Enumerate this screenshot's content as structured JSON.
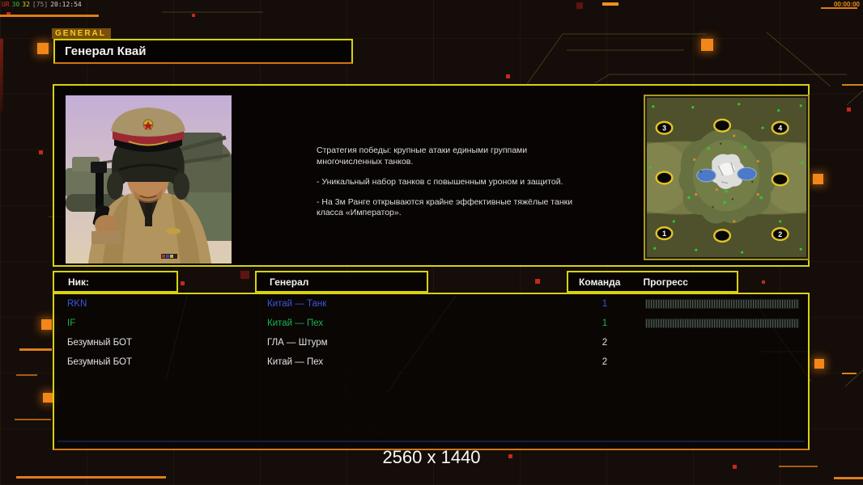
{
  "hud": {
    "debug_parts": [
      {
        "text": "UR",
        "color": "#d03020"
      },
      {
        "text": "30",
        "color": "#30c030"
      },
      {
        "text": "32",
        "color": "#d0d030"
      },
      {
        "text": "[75]",
        "color": "#909090"
      },
      {
        "text": "20:12:54",
        "color": "#d0d0d0"
      }
    ],
    "match_timer": "00:00:00",
    "resolution_label": "2560 x 1440"
  },
  "header": {
    "tab_label": "GENERAL",
    "title": "Генерал Квай"
  },
  "briefing": {
    "paragraphs": [
      "Стратегия победы: крупные атаки едиными группами многочисленных танков.",
      "- Уникальный набор танков с повышенным уроном и защитой.",
      "- На 3м Ранге открываются крайне эффективные тяжёлые танки класса «Император»."
    ]
  },
  "minimap": {
    "positions": [
      {
        "label": "3"
      },
      {
        "label": ""
      },
      {
        "label": "4"
      },
      {
        "label": ""
      },
      {
        "label": ""
      },
      {
        "label": "1"
      },
      {
        "label": ""
      },
      {
        "label": "2"
      }
    ]
  },
  "table": {
    "headers": {
      "nick": "Ник:",
      "general": "Генерал",
      "team": "Команда",
      "progress": "Прогресс"
    },
    "rows": [
      {
        "name": "RKN",
        "general": "Китай — Танк",
        "team": "1",
        "color": "#3c55e0",
        "has_progress": true
      },
      {
        "name": "IF",
        "general": "Китай — Пех",
        "team": "1",
        "color": "#16b455",
        "has_progress": true
      },
      {
        "name": "Безумный БОТ",
        "general": "ГЛА — Штурм",
        "team": "2",
        "color": "#e2e2e2",
        "has_progress": false
      },
      {
        "name": "Безумный БОТ",
        "general": "Китай — Пех",
        "team": "2",
        "color": "#e2e2e2",
        "has_progress": false
      }
    ]
  },
  "colors": {
    "accent_yellow": "#d8d20e",
    "accent_orange": "#cf7412",
    "bright_orange": "#f28618",
    "decor_red": "#c22a1c"
  }
}
